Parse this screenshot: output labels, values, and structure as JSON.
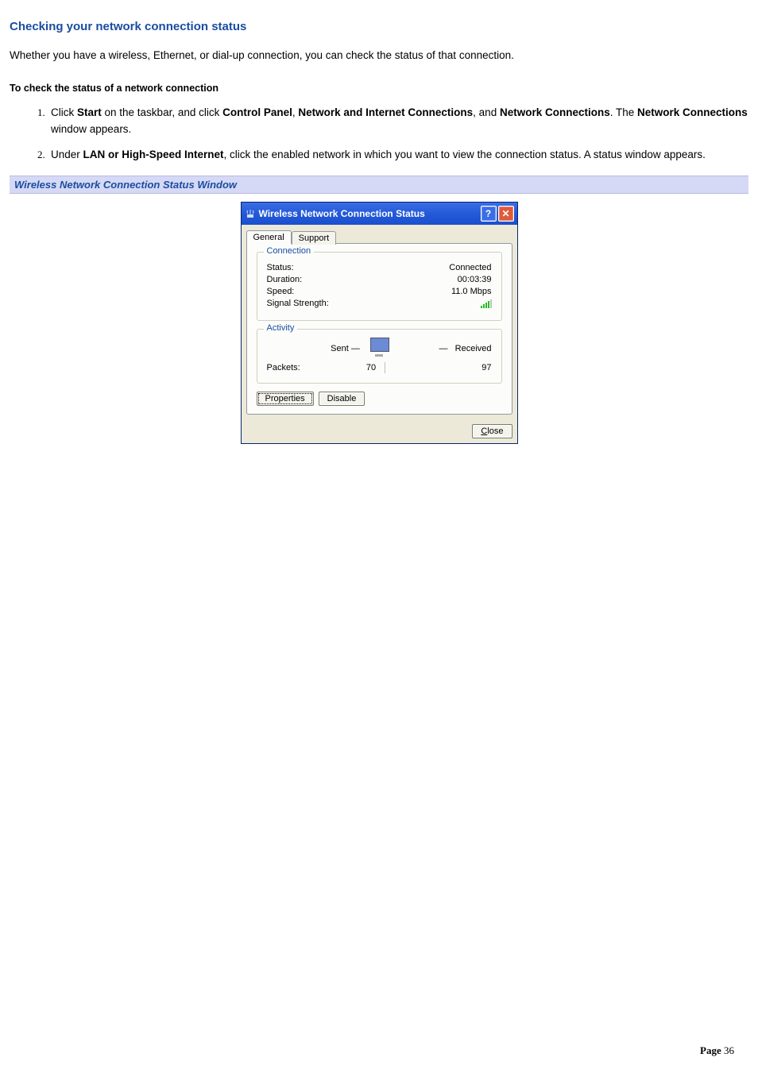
{
  "doc": {
    "heading": "Checking your network connection status",
    "intro": "Whether you have a wireless, Ethernet, or dial-up connection, you can check the status of that connection.",
    "subheading": "To check the status of a network connection",
    "step1_a": "Click ",
    "step1_start": "Start",
    "step1_b": " on the taskbar, and click ",
    "step1_cp": "Control Panel",
    "step1_c": ", ",
    "step1_nic": "Network and Internet Connections",
    "step1_d": ", and ",
    "step1_nc": "Network Connections",
    "step1_e": ". The ",
    "step1_nc2": "Network Connections",
    "step1_f": " window appears.",
    "step2_a": "Under ",
    "step2_lan": "LAN or High-Speed Internet",
    "step2_b": ", click the enabled network in which you want to view the connection status. A status window appears.",
    "fig_caption": "Wireless Network Connection Status Window"
  },
  "window": {
    "title": "Wireless Network Connection Status",
    "help_glyph": "?",
    "close_glyph": "✕",
    "tabs": {
      "general": "General",
      "support": "Support"
    },
    "connection": {
      "group": "Connection",
      "status_label": "Status:",
      "status_value": "Connected",
      "duration_label": "Duration:",
      "duration_value": "00:03:39",
      "speed_label": "Speed:",
      "speed_value": "11.0 Mbps",
      "signal_label": "Signal Strength:"
    },
    "activity": {
      "group": "Activity",
      "sent": "Sent",
      "received": "Received",
      "dash": "—",
      "packets_label": "Packets:",
      "packets_sent": "70",
      "packets_received": "97"
    },
    "buttons": {
      "properties": "Properties",
      "disable": "Disable",
      "close": "Close"
    }
  },
  "footer": {
    "label": "Page ",
    "num": "36"
  }
}
